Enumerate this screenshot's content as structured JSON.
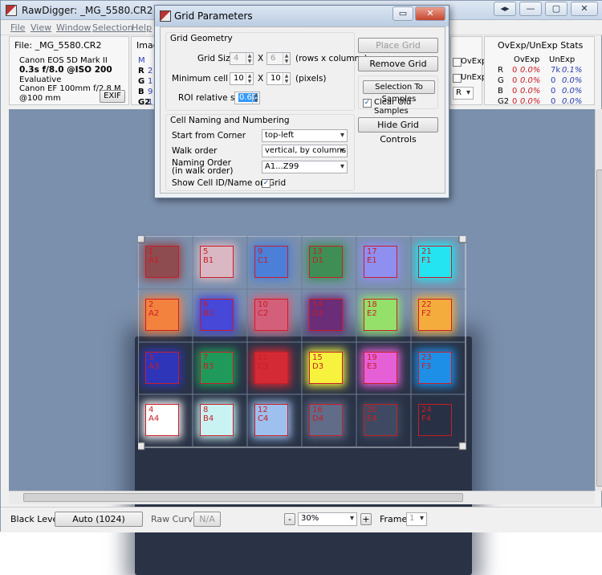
{
  "window": {
    "title": "RawDigger: _MG_5580.CR2"
  },
  "menu": [
    "File",
    "View",
    "Window",
    "Selection",
    "Help"
  ],
  "file_panel": {
    "file": "File: _MG_5580.CR2",
    "camera": "Canon EOS 5D Mark II",
    "exposure": "0.3s f/8.0 @ISO 200",
    "metering": "Evaluative",
    "lens": "Canon EF 100mm f/2.8 M",
    "focal": "@100 mm",
    "exif_btn": "EXIF"
  },
  "image_panel": {
    "title": "Imag",
    "channels": [
      "R",
      "G",
      "B",
      "G2"
    ],
    "vals": [
      "M",
      "2",
      "1",
      "9",
      "1"
    ]
  },
  "ov_panel": {
    "title": "OvExp/UnExp Stats",
    "col1": "OvExp",
    "col2": "UnExp",
    "rows": [
      {
        "ch": "R",
        "ov": "0",
        "ovp": "0.0%",
        "un": "7k",
        "unp": "0.1%"
      },
      {
        "ch": "G",
        "ov": "0",
        "ovp": "0.0%",
        "un": "0",
        "unp": "0.0%"
      },
      {
        "ch": "B",
        "ov": "0",
        "ovp": "0.0%",
        "un": "0",
        "unp": "0.0%"
      },
      {
        "ch": "G2",
        "ov": "0",
        "ovp": "0.0%",
        "un": "0",
        "unp": "0.0%"
      }
    ],
    "ovexp": "OvExp",
    "unexp": "UnExp",
    "r": "R"
  },
  "dialog": {
    "title": "Grid Parameters",
    "geometry_label": "Grid Geometry",
    "grid_size_label": "Grid Size:",
    "grid_rows": "4",
    "grid_cols": "6",
    "x": "X",
    "grid_hint": "(rows x columns)",
    "min_cell_label": "Minimum cell size:",
    "min_w": "10",
    "min_h": "10",
    "min_hint": "(pixels)",
    "roi_label": "ROI relative size:",
    "roi": "0.60",
    "naming_label": "Cell Naming and Numbering",
    "corner_label": "Start from Corner",
    "corner": "top-left",
    "walk_label": "Walk order",
    "walk": "vertical, by columns",
    "naming_order_label": "Naming Order",
    "naming_order_sub": "(in walk order)",
    "naming_order": "A1...Z99",
    "show_label": "Show Cell ID/Name on Grid",
    "place_btn": "Place Grid",
    "remove_btn": "Remove Grid",
    "selection_btn": "Selection To Samples",
    "clear_label": "Clear Old Samples",
    "hide_btn": "Hide Grid Controls"
  },
  "cells": [
    {
      "n": "1",
      "id": "A1",
      "c": "#8e4b50"
    },
    {
      "n": "5",
      "id": "B1",
      "c": "#d9b8c3"
    },
    {
      "n": "9",
      "id": "C1",
      "c": "#4b7fd8"
    },
    {
      "n": "13",
      "id": "D1",
      "c": "#3f8e55"
    },
    {
      "n": "17",
      "id": "E1",
      "c": "#8f8ff0"
    },
    {
      "n": "21",
      "id": "F1",
      "c": "#25e4f2"
    },
    {
      "n": "2",
      "id": "A2",
      "c": "#f2823e"
    },
    {
      "n": "6",
      "id": "B2",
      "c": "#4747d8"
    },
    {
      "n": "10",
      "id": "C2",
      "c": "#d35f7a"
    },
    {
      "n": "14",
      "id": "D2",
      "c": "#6b2c78"
    },
    {
      "n": "18",
      "id": "E2",
      "c": "#94e06a"
    },
    {
      "n": "22",
      "id": "F2",
      "c": "#f4ad3c"
    },
    {
      "n": "3",
      "id": "A3",
      "c": "#2f35b8"
    },
    {
      "n": "7",
      "id": "B3",
      "c": "#1f9a5a"
    },
    {
      "n": "11",
      "id": "C3",
      "c": "#d32a35"
    },
    {
      "n": "15",
      "id": "D3",
      "c": "#f7f23e"
    },
    {
      "n": "19",
      "id": "E3",
      "c": "#e560d6"
    },
    {
      "n": "23",
      "id": "F3",
      "c": "#1e8fe6"
    },
    {
      "n": "4",
      "id": "A4",
      "c": "#ffffff"
    },
    {
      "n": "8",
      "id": "B4",
      "c": "#c9f3f3"
    },
    {
      "n": "12",
      "id": "C4",
      "c": "#9ec0ee"
    },
    {
      "n": "16",
      "id": "D4",
      "c": "#606c88"
    },
    {
      "n": "20",
      "id": "E4",
      "c": "#3f4a62"
    },
    {
      "n": "24",
      "id": "F4",
      "c": "#273044"
    }
  ],
  "status": {
    "black_label": "Black Level:",
    "black_btn": "Auto (1024)",
    "curve_label": "Raw Curve:",
    "curve_btn": "N/A",
    "minus": "-",
    "zoom": "30%",
    "plus": "+",
    "frame_label": "Frame:",
    "frame": "1"
  }
}
